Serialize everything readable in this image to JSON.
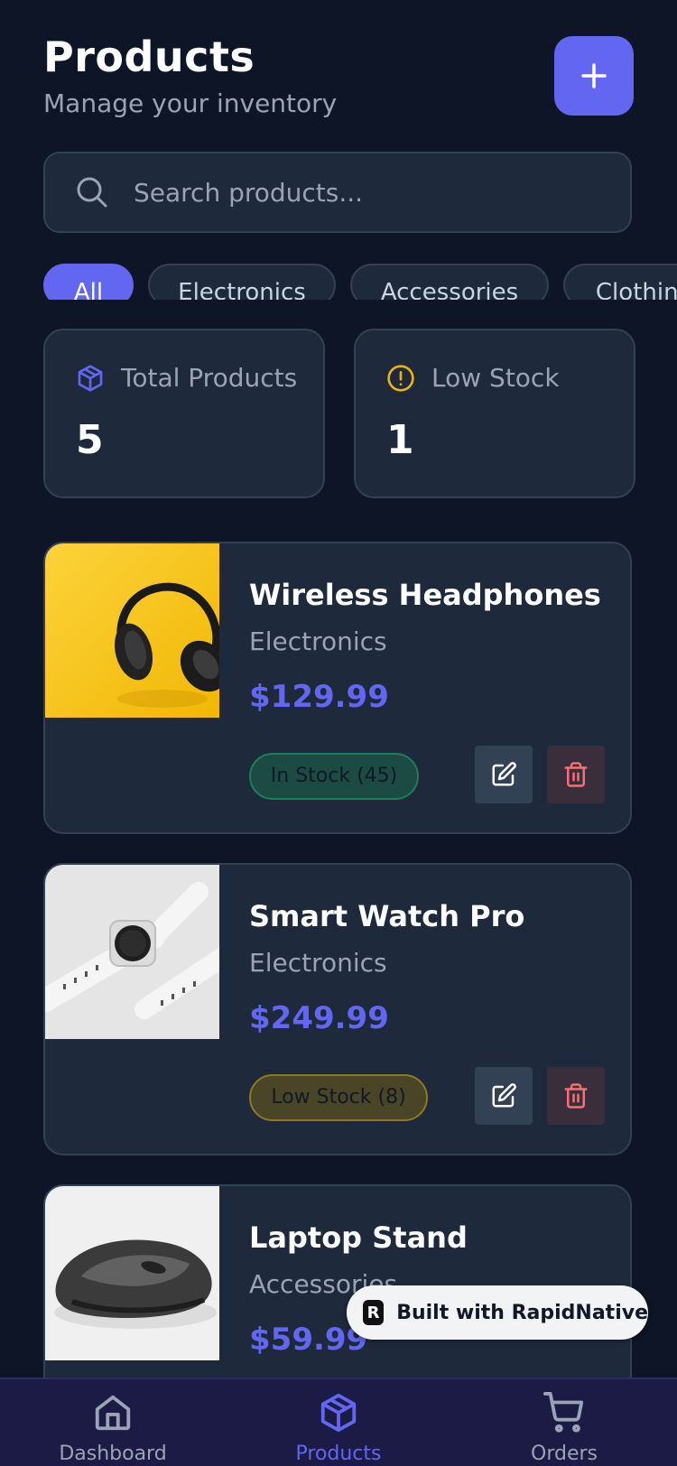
{
  "header": {
    "title": "Products",
    "subtitle": "Manage your inventory",
    "add_icon": "plus-icon"
  },
  "search": {
    "placeholder": "Search products...",
    "value": "",
    "icon": "search-icon"
  },
  "filters": [
    "All",
    "Electronics",
    "Accessories",
    "Clothing"
  ],
  "active_filter": "All",
  "stats": {
    "total": {
      "label": "Total Products",
      "value": "5",
      "icon": "package-icon"
    },
    "low": {
      "label": "Low Stock",
      "value": "1",
      "icon": "alert-circle-icon"
    }
  },
  "products": [
    {
      "name": "Wireless Headphones",
      "category": "Electronics",
      "price": "$129.99",
      "stock_label": "In Stock (45)",
      "stock_status": "in-stock"
    },
    {
      "name": "Smart Watch Pro",
      "category": "Electronics",
      "price": "$249.99",
      "stock_label": "Low Stock (8)",
      "stock_status": "low-stock"
    },
    {
      "name": "Laptop Stand",
      "category": "Accessories",
      "price": "$59.99"
    }
  ],
  "promo": {
    "label": "Built with RapidNative"
  },
  "nav": [
    {
      "label": "Dashboard",
      "icon": "home-icon"
    },
    {
      "label": "Products",
      "icon": "package-icon"
    },
    {
      "label": "Orders",
      "icon": "cart-icon"
    }
  ],
  "colors": {
    "background": "#0d1526",
    "card": "#1e293b",
    "accent": "#6366f1",
    "warning": "#eab308",
    "danger": "#f87171",
    "muted": "#9ba3b4"
  }
}
